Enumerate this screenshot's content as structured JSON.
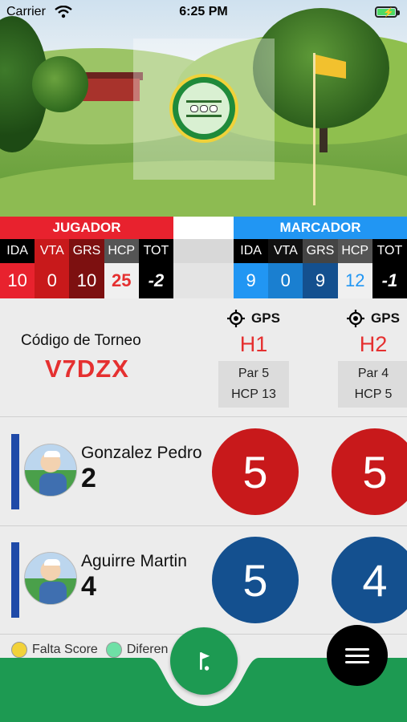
{
  "status": {
    "carrier": "Carrier",
    "time": "6:25 PM"
  },
  "jugador": {
    "title": "JUGADOR",
    "columns": [
      "IDA",
      "VTA",
      "GRS",
      "HCP",
      "TOT"
    ],
    "values": [
      "10",
      "0",
      "10",
      "25",
      "-2"
    ]
  },
  "marcador": {
    "title": "MARCADOR",
    "columns": [
      "IDA",
      "VTA",
      "GRS",
      "HCP",
      "TOT"
    ],
    "values": [
      "9",
      "0",
      "9",
      "12",
      "-1"
    ]
  },
  "tournament": {
    "label": "Código de Torneo",
    "code": "V7DZX"
  },
  "holes": [
    {
      "gps": "GPS",
      "name": "H1",
      "par": "Par 5",
      "hcp": "HCP 13"
    },
    {
      "gps": "GPS",
      "name": "H2",
      "par": "Par 4",
      "hcp": "HCP 5"
    }
  ],
  "players": [
    {
      "name": "Gonzalez Pedro",
      "handicap": "2",
      "scores": [
        "5",
        "5"
      ],
      "score_color": "red"
    },
    {
      "name": "Aguirre Martin",
      "handicap": "4",
      "scores": [
        "5",
        "4"
      ],
      "score_color": "blue"
    }
  ],
  "legend": [
    {
      "label": "Falta Score",
      "color": "#f2d23a"
    },
    {
      "label": "Diferen",
      "color": "#6fe0a6"
    }
  ],
  "colors": {
    "jugador_header": "#e8222e",
    "marcador_header": "#2196f3",
    "score_red": "#c8191b",
    "score_blue": "#14508f",
    "bottom_green": "#1d9a52",
    "accent_red": "#e53030"
  },
  "icons": {
    "gps": "crosshair-target-icon",
    "flag_button": "golf-flag-icon",
    "menu_button": "hamburger-menu-icon"
  }
}
